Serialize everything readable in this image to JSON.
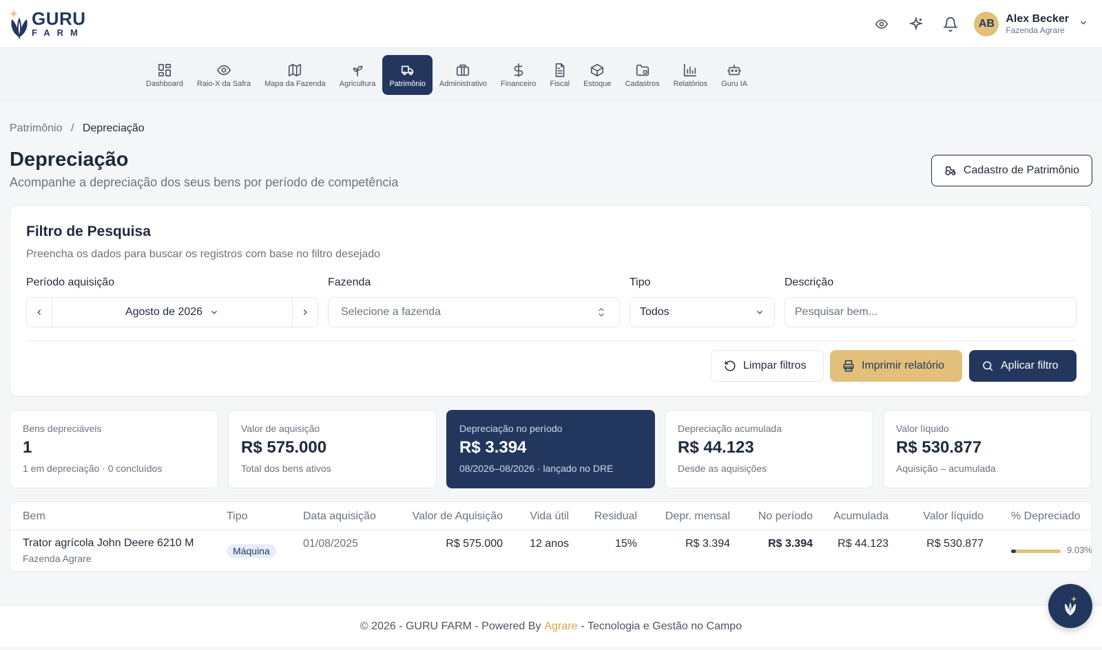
{
  "brand": {
    "line1": "GURU",
    "line2": "FARM"
  },
  "user": {
    "initials": "AB",
    "name": "Alex Becker",
    "farm": "Fazenda Agrare"
  },
  "nav": [
    {
      "label": "Dashboard",
      "icon": "dashboard-icon"
    },
    {
      "label": "Raio-X da Safra",
      "icon": "eye-icon"
    },
    {
      "label": "Mapa da Fazenda",
      "icon": "map-icon"
    },
    {
      "label": "Agricultura",
      "icon": "sprout-icon"
    },
    {
      "label": "Patrimônio",
      "icon": "truck-icon",
      "active": true
    },
    {
      "label": "Administrativo",
      "icon": "briefcase-icon"
    },
    {
      "label": "Financeiro",
      "icon": "dollar-icon"
    },
    {
      "label": "Fiscal",
      "icon": "document-icon"
    },
    {
      "label": "Estoque",
      "icon": "box-icon"
    },
    {
      "label": "Cadastros",
      "icon": "folder-gear-icon"
    },
    {
      "label": "Relatórios",
      "icon": "bar-chart-icon"
    },
    {
      "label": "Guru IA",
      "icon": "bot-icon"
    }
  ],
  "breadcrumb": {
    "parent": "Patrimônio",
    "separator": "/",
    "current": "Depreciação"
  },
  "page": {
    "title": "Depreciação",
    "subtitle": "Acompanhe a depreciação dos seus bens por período de competência",
    "cadastro_button": "Cadastro de Patrimônio"
  },
  "filter": {
    "title": "Filtro de Pesquisa",
    "subtitle": "Preencha os dados para buscar os registros com base no filtro desejado",
    "periodo_label": "Período aquisição",
    "periodo_value": "Agosto de 2026",
    "fazenda_label": "Fazenda",
    "fazenda_placeholder": "Selecione a fazenda",
    "tipo_label": "Tipo",
    "tipo_value": "Todos",
    "descricao_label": "Descrição",
    "descricao_placeholder": "Pesquisar bem...",
    "limpar": "Limpar filtros",
    "imprimir": "Imprimir relatório",
    "aplicar": "Aplicar filtro"
  },
  "kpis": [
    {
      "label": "Bens depreciáveis",
      "value": "1",
      "sub": "1 em depreciação · 0 concluídos"
    },
    {
      "label": "Valor de aquisição",
      "value": "R$ 575.000",
      "sub": "Total dos bens ativos"
    },
    {
      "label": "Depreciação no período",
      "value": "R$ 3.394",
      "sub": "08/2026–08/2026 · lançado no DRE",
      "highlight": true
    },
    {
      "label": "Depreciação acumulada",
      "value": "R$ 44.123",
      "sub": "Desde as aquisições"
    },
    {
      "label": "Valor líquido",
      "value": "R$ 530.877",
      "sub": "Aquisição – acumulada"
    }
  ],
  "table": {
    "headers": [
      "Bem",
      "Tipo",
      "Data aquisição",
      "Valor de Aquisição",
      "Vida útil",
      "Residual",
      "Depr. mensal",
      "No período",
      "Acumulada",
      "Valor líquido",
      "% Depreciado"
    ],
    "rows": [
      {
        "bem": "Trator agrícola John Deere 6210 M",
        "fazenda": "Fazenda Agrare",
        "tipo": "Máquina",
        "data": "01/08/2025",
        "valor": "R$ 575.000",
        "vida": "12 anos",
        "residual": "15%",
        "mensal": "R$ 3.394",
        "periodo": "R$ 3.394",
        "acumulada": "R$ 44.123",
        "liquido": "R$ 530.877",
        "pct_text": "9.03%",
        "pct": 9.03
      }
    ]
  },
  "footer": {
    "prefix": "© 2026 - GURU FARM - Powered By",
    "brand": "Agrare",
    "suffix": "- Tecnologia e Gestão no Campo"
  },
  "colors": {
    "primary": "#23375e",
    "accent": "#e2c07a",
    "brand_link": "#d4a64a"
  }
}
